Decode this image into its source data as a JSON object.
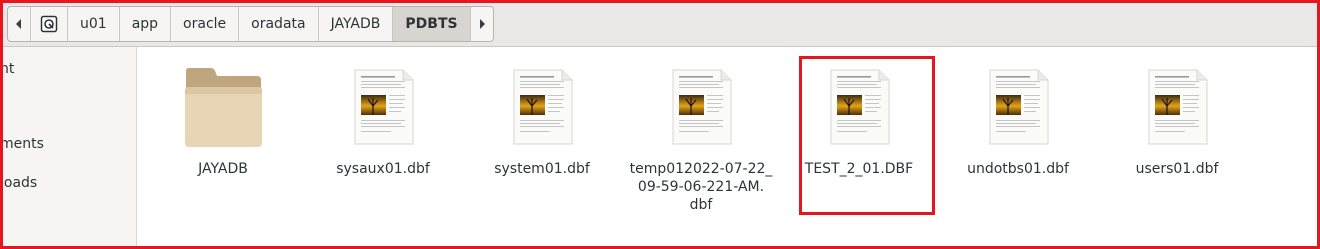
{
  "breadcrumb": {
    "segments": [
      {
        "label": "u01"
      },
      {
        "label": "app"
      },
      {
        "label": "oracle"
      },
      {
        "label": "oradata"
      },
      {
        "label": "JAYADB"
      },
      {
        "label": "PDBTS"
      }
    ]
  },
  "sidebar": {
    "items": [
      {
        "label": "nt"
      },
      {
        "label": "ments"
      },
      {
        "label": "loads"
      }
    ]
  },
  "files": [
    {
      "name": "JAYADB",
      "type": "folder"
    },
    {
      "name": "sysaux01.dbf",
      "type": "document"
    },
    {
      "name": "system01.dbf",
      "type": "document"
    },
    {
      "name": "temp012022-07-22_09-59-06-221-AM.dbf",
      "line1": "temp012022-07-22_",
      "line2": "09-59-06-221-AM.",
      "line3": "dbf",
      "type": "document"
    },
    {
      "name": "TEST_2_01.DBF",
      "type": "document"
    },
    {
      "name": "undotbs01.dbf",
      "type": "document"
    },
    {
      "name": "users01.dbf",
      "type": "document"
    }
  ],
  "icons": {
    "back": "chevron-left-icon",
    "forward": "chevron-right-icon",
    "home": "disk-icon",
    "folder": "folder-icon",
    "document": "document-thumbnail-icon"
  },
  "colors": {
    "annotation": "#e4161f",
    "folder": "#dcc7a3",
    "active_segment": "#d8d4d0"
  }
}
